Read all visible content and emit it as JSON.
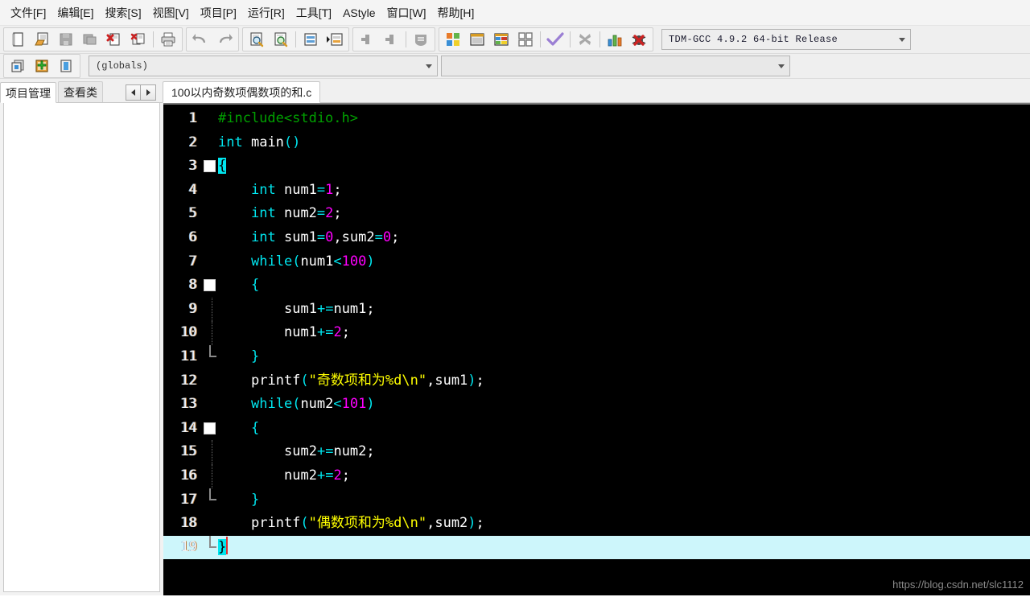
{
  "menubar": {
    "items": [
      {
        "name": "file",
        "label": "文件[F]"
      },
      {
        "name": "edit",
        "label": "编辑[E]"
      },
      {
        "name": "search",
        "label": "搜索[S]"
      },
      {
        "name": "view",
        "label": "视图[V]"
      },
      {
        "name": "project",
        "label": "项目[P]"
      },
      {
        "name": "run",
        "label": "运行[R]"
      },
      {
        "name": "tools",
        "label": "工具[T]"
      },
      {
        "name": "astyle",
        "label": "AStyle"
      },
      {
        "name": "window",
        "label": "窗口[W]"
      },
      {
        "name": "help",
        "label": "帮助[H]"
      }
    ]
  },
  "toolbar": {
    "icons": [
      "new-file-icon",
      "open-file-icon",
      "save-file-icon",
      "save-all-icon",
      "close-file-icon",
      "close-all-icon",
      "print-icon",
      "undo-icon",
      "redo-icon",
      "find-icon",
      "replace-icon",
      "goto-line-icon",
      "goto-function-icon",
      "back-icon",
      "forward-icon",
      "toggle-icon",
      "compile-icon",
      "run-icon",
      "compile-run-icon",
      "rebuild-all-icon",
      "syntax-check-icon",
      "stop-icon",
      "profile-icon",
      "debug-icon"
    ],
    "compiler": {
      "value": "TDM-GCC 4.9.2 64-bit Release"
    }
  },
  "toolbar2": {
    "icons": [
      "new-project-icon",
      "add-to-project-icon",
      "remove-from-project-icon"
    ],
    "scope_combo": {
      "value": "(globals)"
    },
    "member_combo": {
      "value": ""
    }
  },
  "panel_tabs": [
    {
      "name": "project-manager",
      "label": "项目管理",
      "active": true
    },
    {
      "name": "class-browser",
      "label": "查看类",
      "active": false
    }
  ],
  "nav_buttons": {
    "prev": "prev-tab-icon",
    "next": "next-tab-icon"
  },
  "file_tabs": [
    {
      "name": "source-file",
      "label": "100以内奇数项偶数项的和.c",
      "active": true
    }
  ],
  "editor": {
    "language": "c",
    "current_line": 19,
    "colors": {
      "background": "#000000",
      "preprocessor": "#00a000",
      "keyword": "#00e5ee",
      "number": "#ff00ff",
      "string": "#ffff00",
      "identifier": "#ffffff",
      "current_line_bg": "#cdf6fb",
      "brace_match_bg": "#00e5ee",
      "cursor": "#e03030"
    },
    "lines": [
      {
        "n": "1",
        "text": "#include<stdio.h>"
      },
      {
        "n": "2",
        "text": "int main()"
      },
      {
        "n": "3",
        "text": "{"
      },
      {
        "n": "4",
        "text": "    int num1=1;"
      },
      {
        "n": "5",
        "text": "    int num2=2;"
      },
      {
        "n": "6",
        "text": "    int sum1=0,sum2=0;"
      },
      {
        "n": "7",
        "text": "    while(num1<100)"
      },
      {
        "n": "8",
        "text": "    {"
      },
      {
        "n": "9",
        "text": "        sum1+=num1;"
      },
      {
        "n": "10",
        "text": "        num1+=2;"
      },
      {
        "n": "11",
        "text": "    }"
      },
      {
        "n": "12",
        "text": "    printf(\"奇数项和为%d\\n\",sum1);"
      },
      {
        "n": "13",
        "text": "    while(num2<101)"
      },
      {
        "n": "14",
        "text": "    {"
      },
      {
        "n": "15",
        "text": "        sum2+=num2;"
      },
      {
        "n": "16",
        "text": "        num2+=2;"
      },
      {
        "n": "17",
        "text": "    }"
      },
      {
        "n": "18",
        "text": "    printf(\"偶数项和为%d\\n\",sum2);"
      },
      {
        "n": "19",
        "text": "}"
      }
    ]
  },
  "watermark": {
    "text": "https://blog.csdn.net/slc1112"
  }
}
